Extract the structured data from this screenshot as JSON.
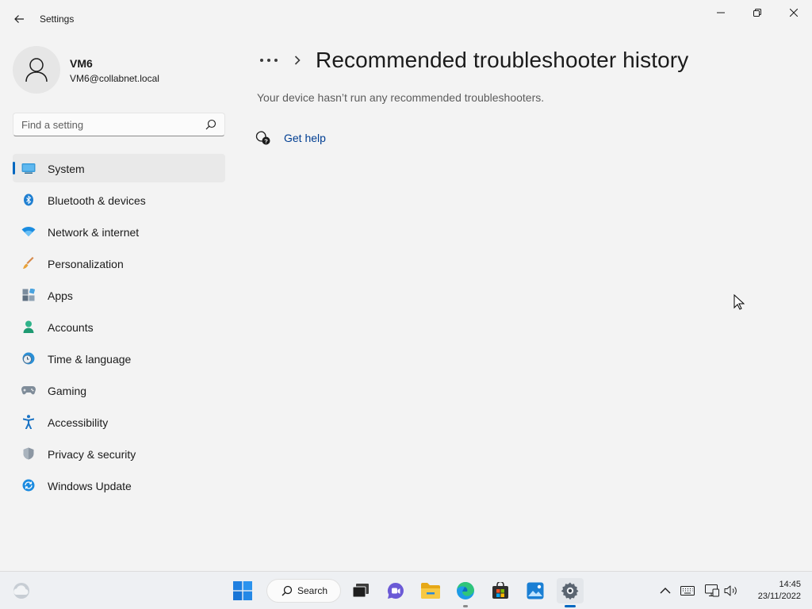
{
  "window": {
    "app_title": "Settings",
    "controls": [
      "minimize",
      "maximize",
      "close"
    ]
  },
  "profile": {
    "name": "VM6",
    "email": "VM6@collabnet.local",
    "avatar_icon": "person-icon"
  },
  "search": {
    "placeholder": "Find a setting",
    "value": ""
  },
  "sidebar": {
    "selected": "System",
    "items": [
      {
        "label": "System",
        "icon": "monitor-icon"
      },
      {
        "label": "Bluetooth & devices",
        "icon": "bluetooth-icon"
      },
      {
        "label": "Network & internet",
        "icon": "wifi-icon"
      },
      {
        "label": "Personalization",
        "icon": "brush-icon"
      },
      {
        "label": "Apps",
        "icon": "apps-icon"
      },
      {
        "label": "Accounts",
        "icon": "account-icon"
      },
      {
        "label": "Time & language",
        "icon": "clock-globe-icon"
      },
      {
        "label": "Gaming",
        "icon": "gamepad-icon"
      },
      {
        "label": "Accessibility",
        "icon": "accessibility-icon"
      },
      {
        "label": "Privacy & security",
        "icon": "shield-icon"
      },
      {
        "label": "Windows Update",
        "icon": "update-icon"
      }
    ]
  },
  "main": {
    "breadcrumb_more": "•••",
    "title": "Recommended troubleshooter history",
    "description": "Your device hasn’t run any recommended troubleshooters.",
    "get_help_label": "Get help"
  },
  "taskbar": {
    "search_label": "Search",
    "time": "14:45",
    "date": "23/11/2022",
    "apps": [
      "start-icon",
      "search-icon",
      "task-view-icon",
      "chat-icon",
      "file-explorer-icon",
      "edge-icon",
      "store-icon",
      "photos-icon",
      "settings-gear-icon"
    ]
  },
  "colors": {
    "accent": "#0067c0",
    "background": "#f3f3f3",
    "link": "#003e92"
  }
}
